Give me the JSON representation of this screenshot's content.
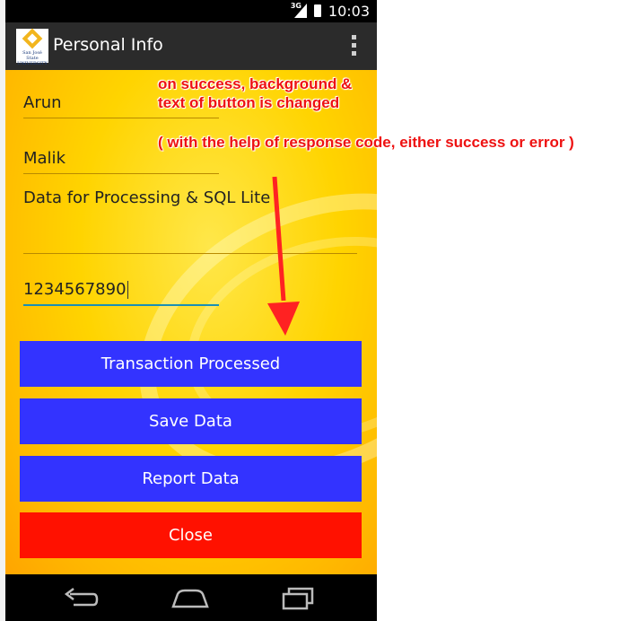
{
  "status_bar": {
    "network": "3G",
    "time": "10:03"
  },
  "action_bar": {
    "title": "Personal Info",
    "logo_text": "San José State UNIVERSITY"
  },
  "form": {
    "first_name": "Arun",
    "last_name": "Malik",
    "description": "Data for Processing & SQL Lite",
    "phone": "1234567890"
  },
  "buttons": {
    "transaction": "Transaction Processed",
    "save": "Save Data",
    "report": "Report Data",
    "close": "Close"
  },
  "annotations": {
    "line1": "on success, background &",
    "line2": "text of button is changed",
    "line3": "( with the help of response code, either success or error )"
  },
  "colors": {
    "button_blue": "#3333ff",
    "close_red": "#ff1100",
    "background_yellow": "#ffd400",
    "annotation_red": "#ee1111"
  },
  "icons": {
    "back": "back-icon",
    "home": "home-icon",
    "recents": "recents-icon",
    "overflow": "overflow-menu-icon"
  }
}
